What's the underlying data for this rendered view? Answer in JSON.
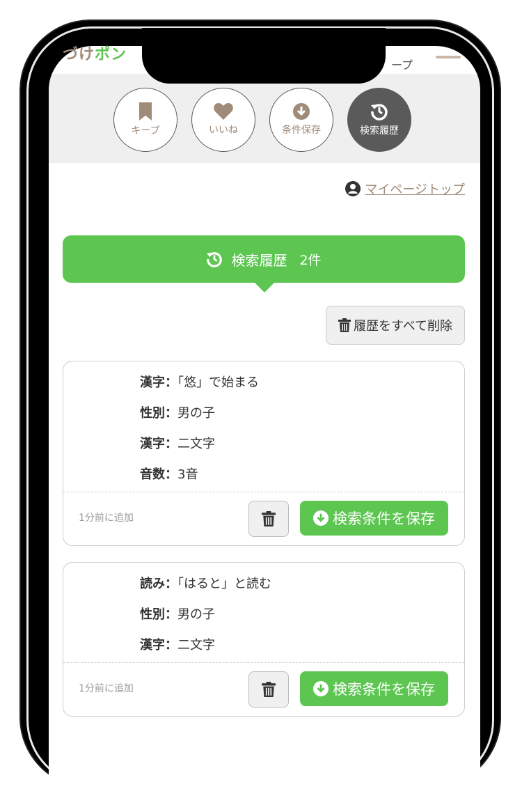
{
  "status": {
    "logo_partial": "づけ",
    "logo_green": "ポン",
    "right_text": "ープ"
  },
  "tabs": [
    {
      "label": "キープ",
      "icon": "bookmark-icon"
    },
    {
      "label": "いいね",
      "icon": "heart-icon"
    },
    {
      "label": "条件保存",
      "icon": "download-circle-icon"
    },
    {
      "label": "検索履歴",
      "icon": "history-icon",
      "active": true
    }
  ],
  "mypage_link": "マイページトップ",
  "banner": {
    "title": "検索履歴",
    "count": "2件"
  },
  "delete_all": "履歴をすべて削除",
  "history": [
    {
      "conditions": [
        {
          "key": "漢字：",
          "value": "「悠」で始まる"
        },
        {
          "key": "性別：",
          "value": "男の子"
        },
        {
          "key": "漢字：",
          "value": "二文字"
        },
        {
          "key": "音数：",
          "value": "3音"
        }
      ],
      "added": "1分前に追加",
      "save_label": "検索条件を保存"
    },
    {
      "conditions": [
        {
          "key": "読み：",
          "value": "「はると」と読む"
        },
        {
          "key": "性別：",
          "value": "男の子"
        },
        {
          "key": "漢字：",
          "value": "二文字"
        }
      ],
      "added": "1分前に追加",
      "save_label": "検索条件を保存"
    }
  ],
  "colors": {
    "accent": "#5cc651",
    "brown": "#a08a78",
    "active_tab": "#5a5a5a"
  }
}
